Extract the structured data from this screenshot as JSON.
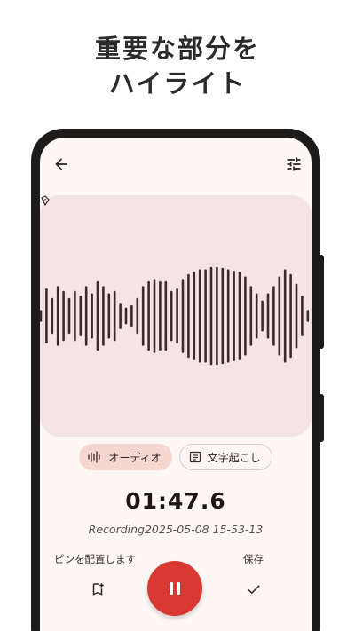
{
  "headline": {
    "line1": "重要な部分を",
    "line2": "ハイライト"
  },
  "tabs": {
    "audio_label": "オーディオ",
    "transcript_label": "文字起こし"
  },
  "recording": {
    "elapsed": "01:47.6",
    "filename": "Recording2025-05-08 15-53-13"
  },
  "controls": {
    "pin_label": "ピンを配置します",
    "save_label": "保存"
  },
  "waveform": {
    "amplitudes": [
      0.1,
      0.55,
      0.35,
      0.6,
      0.5,
      0.35,
      0.5,
      0.4,
      0.6,
      0.45,
      0.7,
      0.6,
      0.45,
      0.5,
      0.25,
      0.15,
      0.2,
      0.35,
      0.6,
      0.7,
      0.75,
      0.7,
      0.7,
      0.5,
      0.55,
      0.75,
      0.85,
      0.9,
      0.95,
      0.95,
      1.0,
      1.0,
      0.98,
      0.95,
      0.92,
      0.9,
      0.8,
      0.6,
      0.45,
      0.3,
      0.45,
      0.6,
      0.8,
      0.95,
      0.85,
      0.65,
      0.4,
      0.1
    ]
  },
  "colors": {
    "accent": "#d83a33",
    "chip_active": "#f6d6d1",
    "wave_bg": "#f5e4e1",
    "wave_bar": "#3b2a2a",
    "screen_bg": "#fdf7f6"
  },
  "icons": {
    "back": "arrow-left-icon",
    "settings": "tune-icon",
    "audio": "waveform-icon",
    "transcript": "document-icon",
    "pin": "bookmark-add-icon",
    "pause": "pause-icon",
    "save": "check-icon"
  }
}
